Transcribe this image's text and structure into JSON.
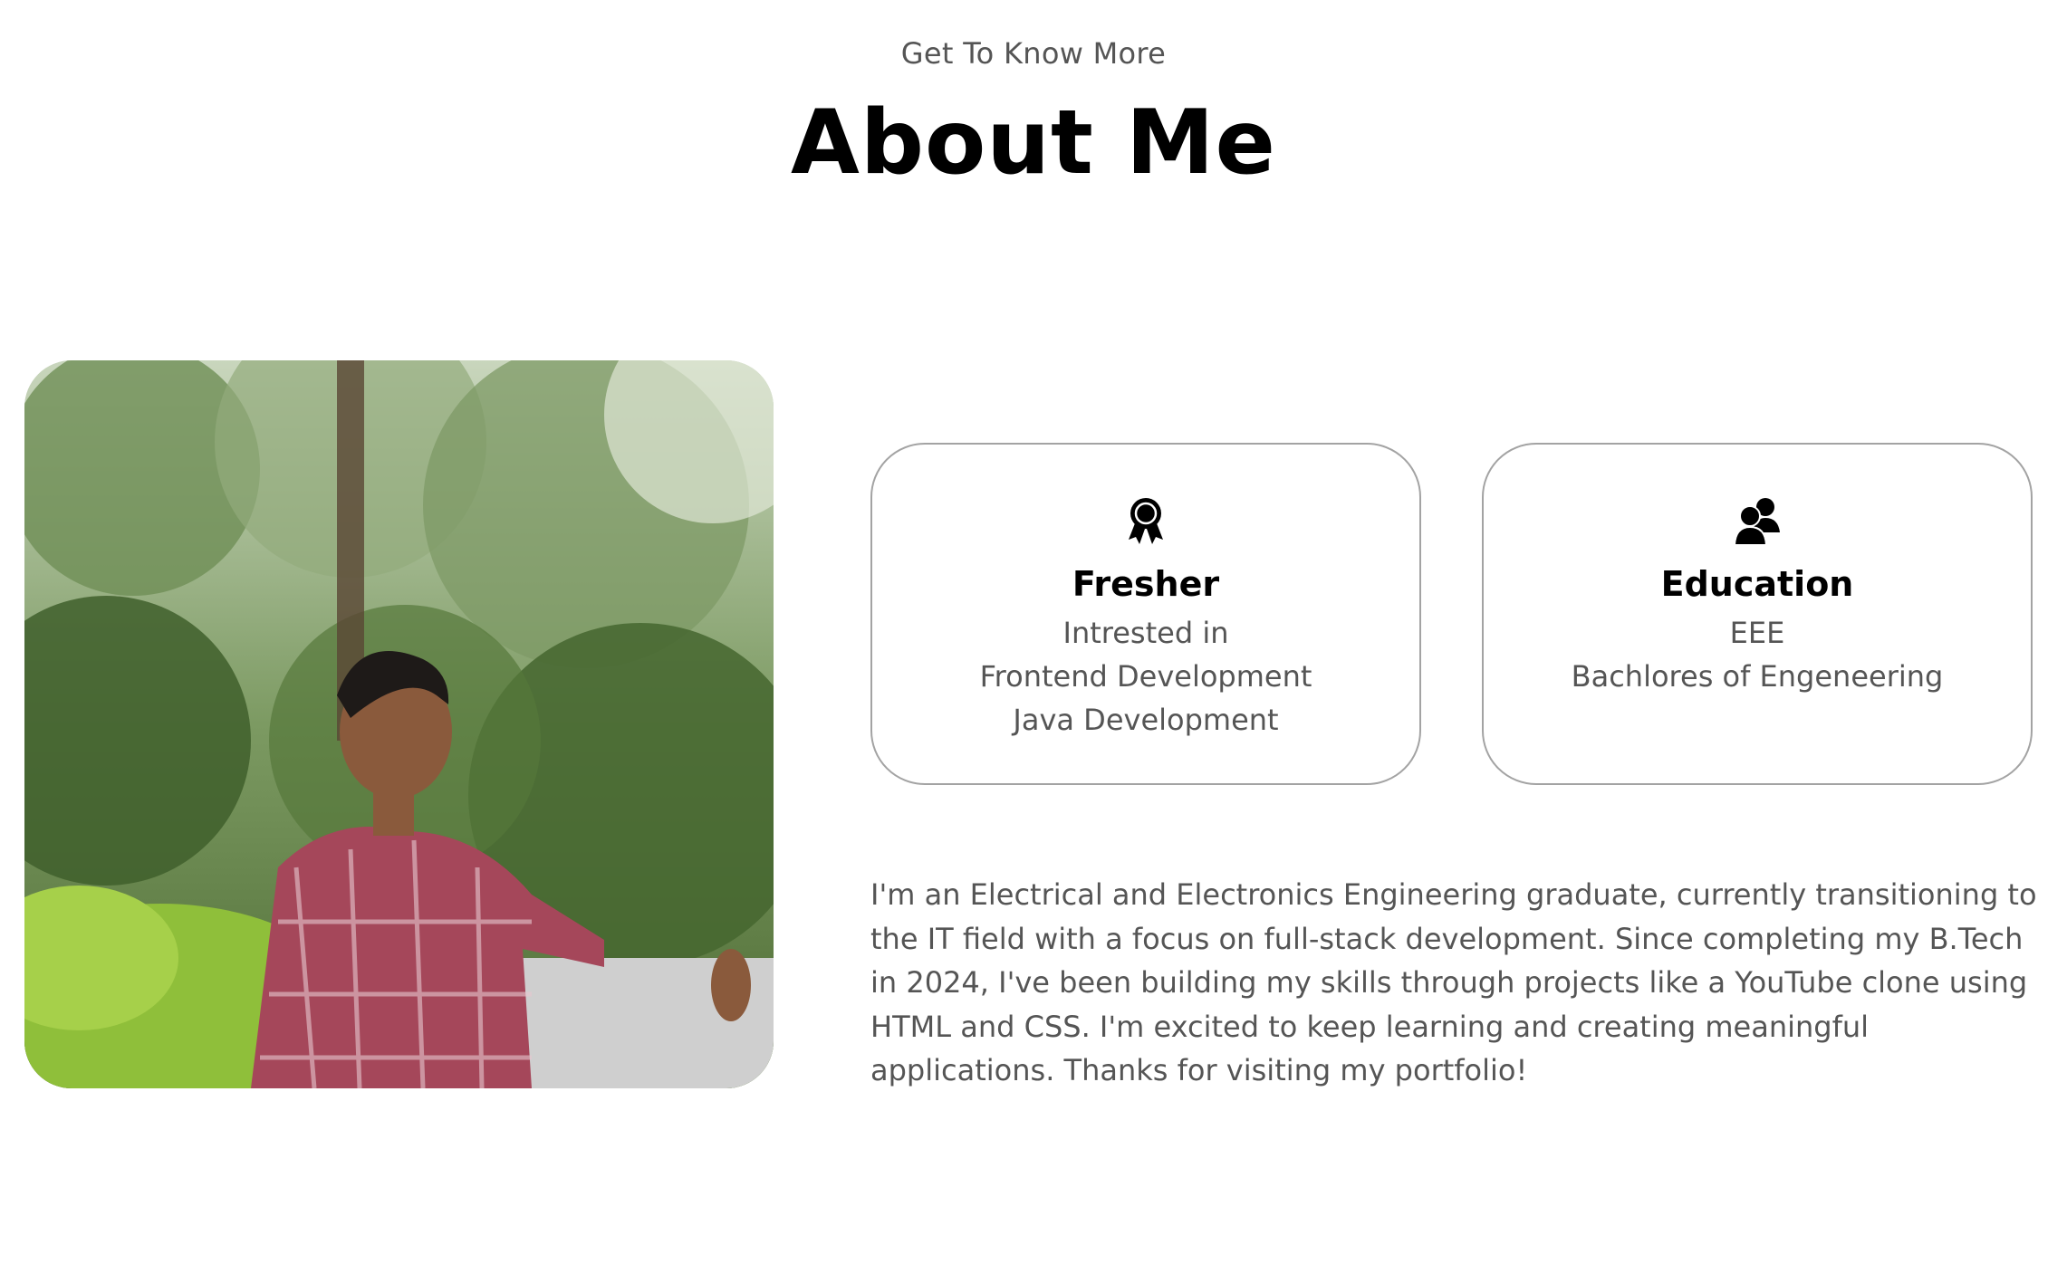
{
  "header": {
    "subtitle": "Get To Know More",
    "title": "About Me"
  },
  "photo": {
    "alt": "Profile picture",
    "icon": "profile-photo"
  },
  "cards": [
    {
      "icon": "award-ribbon-icon",
      "title": "Fresher",
      "lines": [
        "Intrested in",
        "Frontend Development",
        "Java Development"
      ]
    },
    {
      "icon": "users-icon",
      "title": "Education",
      "lines": [
        "EEE",
        "Bachlores of Engeneering",
        ""
      ]
    }
  ],
  "bio": {
    "text": "I'm an Electrical and Electronics Engineering graduate, currently transitioning to the IT field with a focus on full-stack development. Since completing my B.Tech in 2024, I've been building my skills through projects like a YouTube clone using HTML and CSS. I'm excited to keep learning and creating meaningful applications. Thanks for visiting my portfolio!"
  },
  "colors": {
    "text_primary": "#000000",
    "text_secondary": "#555555",
    "card_border": "#a3a3a3",
    "background": "#ffffff"
  }
}
